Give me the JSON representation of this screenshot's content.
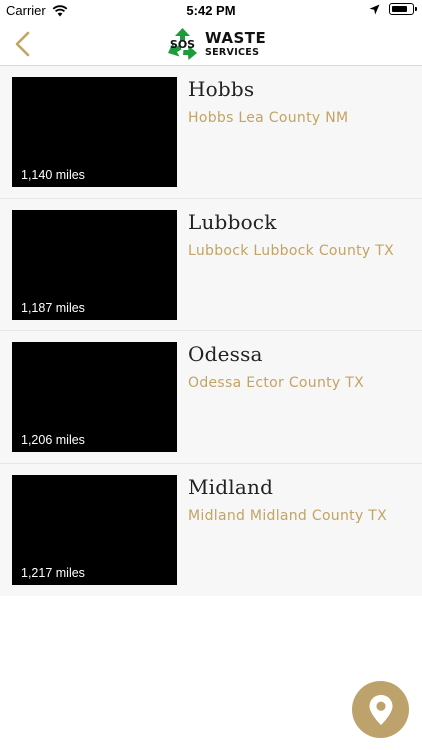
{
  "status_bar": {
    "carrier": "Carrier",
    "time": "5:42 PM",
    "battery_level": 0.8
  },
  "nav": {
    "back_icon": "chevron-left-icon",
    "logo": {
      "mark": "SOS",
      "line1": "WASTE",
      "line2": "SERVICES"
    }
  },
  "colors": {
    "accent": "#bda36b",
    "subtitle": "#c2a464",
    "logo_green": "#1e9b3a",
    "list_bg": "#f7f7f7"
  },
  "locations": [
    {
      "city": "Hobbs",
      "subtitle": "Hobbs Lea County NM",
      "distance": "1,140 miles"
    },
    {
      "city": "Lubbock",
      "subtitle": "Lubbock Lubbock County TX",
      "distance": "1,187 miles"
    },
    {
      "city": "Odessa",
      "subtitle": "Odessa Ector County TX",
      "distance": "1,206 miles"
    },
    {
      "city": "Midland",
      "subtitle": "Midland Midland County TX",
      "distance": "1,217 miles"
    }
  ],
  "fab": {
    "icon": "map-pin-icon"
  }
}
